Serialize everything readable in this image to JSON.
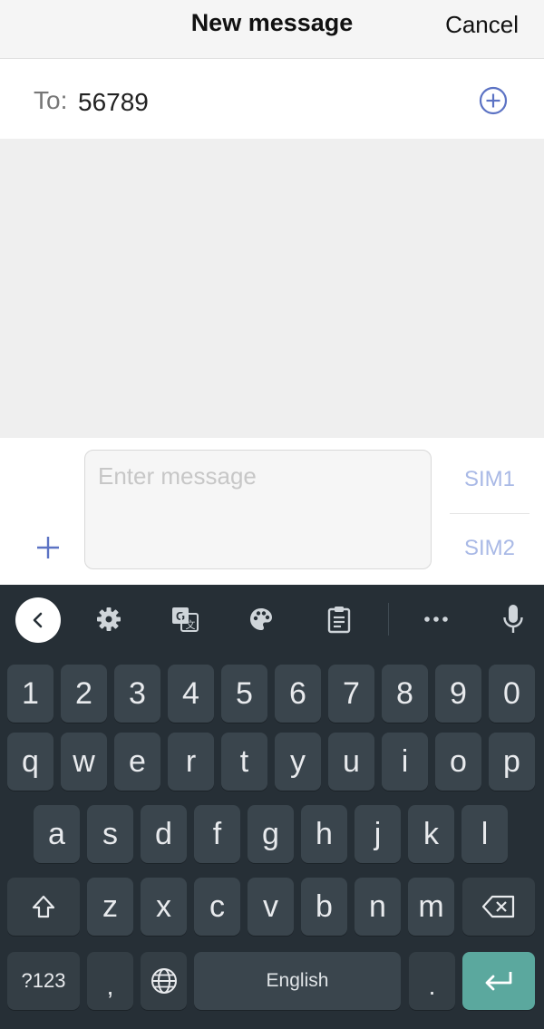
{
  "header": {
    "title": "New message",
    "cancel": "Cancel"
  },
  "recipient": {
    "label": "To:",
    "value": "56789"
  },
  "compose": {
    "placeholder": "Enter message",
    "sim1": "SIM1",
    "sim2": "SIM2"
  },
  "keyboard": {
    "numbers": [
      "1",
      "2",
      "3",
      "4",
      "5",
      "6",
      "7",
      "8",
      "9",
      "0"
    ],
    "row1": [
      "q",
      "w",
      "e",
      "r",
      "t",
      "y",
      "u",
      "i",
      "o",
      "p"
    ],
    "row2": [
      "a",
      "s",
      "d",
      "f",
      "g",
      "h",
      "j",
      "k",
      "l"
    ],
    "row3": [
      "z",
      "x",
      "c",
      "v",
      "b",
      "n",
      "m"
    ],
    "symbols_key": "?123",
    "comma_key": ",",
    "space_label": "English",
    "period_key": "."
  },
  "icons": [
    "add-contact-icon",
    "attach-plus-icon",
    "back-chevron-icon",
    "settings-gear-icon",
    "translate-icon",
    "palette-icon",
    "clipboard-icon",
    "more-dots-icon",
    "microphone-icon",
    "shift-icon",
    "backspace-icon",
    "globe-icon",
    "enter-icon"
  ],
  "colors": {
    "accent": "#5c73c4",
    "sim_text": "#a9b9e6",
    "keyboard_bg": "#262f36",
    "key_bg": "#3a454d",
    "enter_key": "#5ba89e"
  }
}
